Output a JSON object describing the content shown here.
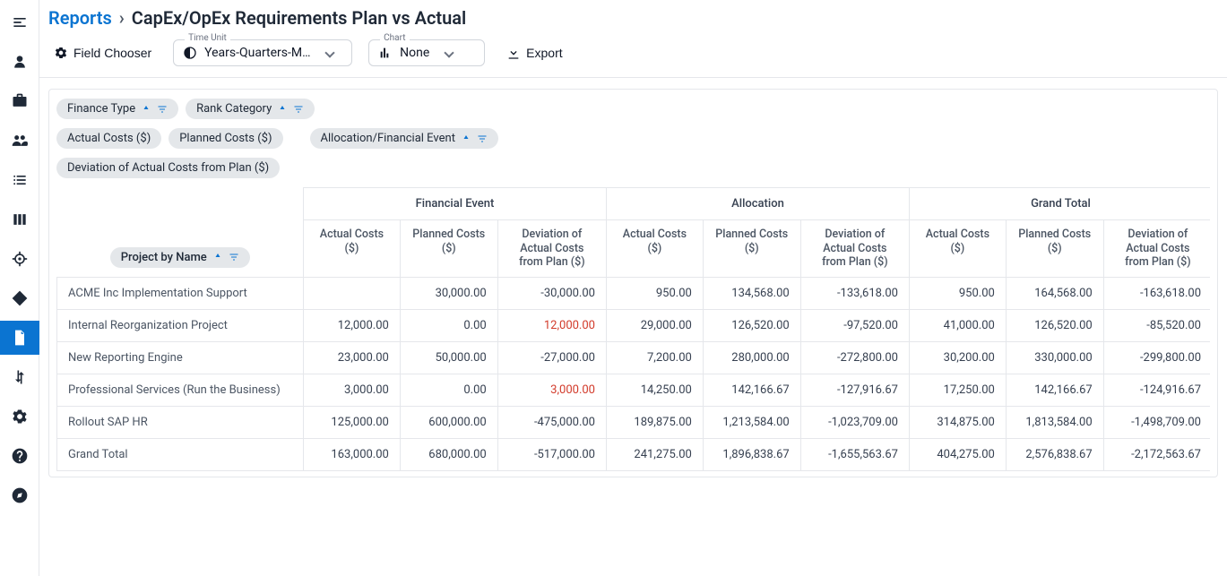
{
  "breadcrumb": {
    "root": "Reports",
    "title": "CapEx/OpEx Requirements Plan vs Actual"
  },
  "toolbar": {
    "fieldChooser": "Field Chooser",
    "timeUnitLabel": "Time Unit",
    "timeUnitValue": "Years-Quarters-M…",
    "chartLabel": "Chart",
    "chartValue": "None",
    "export": "Export"
  },
  "chips": {
    "financeType": "Finance Type",
    "rankCategory": "Rank Category",
    "actualCosts": "Actual Costs ($)",
    "plannedCosts": "Planned Costs ($)",
    "allocFinEvent": "Allocation/Financial Event",
    "deviation": "Deviation of Actual Costs from Plan ($)",
    "projectByName": "Project by Name"
  },
  "headers": {
    "group1": "Financial Event",
    "group2": "Allocation",
    "group3": "Grand Total",
    "actual": "Actual Costs ($)",
    "planned": "Planned Costs ($)",
    "dev": "Deviation of Actual Costs from Plan ($)"
  },
  "rows": [
    {
      "name": "ACME Inc Implementation Support",
      "fe_actual": "",
      "fe_planned": "30,000.00",
      "fe_dev": "-30,000.00",
      "al_actual": "950.00",
      "al_planned": "134,568.00",
      "al_dev": "-133,618.00",
      "gt_actual": "950.00",
      "gt_planned": "164,568.00",
      "gt_dev": "-163,618.00"
    },
    {
      "name": "Internal Reorganization Project",
      "fe_actual": "12,000.00",
      "fe_planned": "0.00",
      "fe_dev": "12,000.00",
      "fe_dev_pos": true,
      "al_actual": "29,000.00",
      "al_planned": "126,520.00",
      "al_dev": "-97,520.00",
      "gt_actual": "41,000.00",
      "gt_planned": "126,520.00",
      "gt_dev": "-85,520.00"
    },
    {
      "name": "New Reporting Engine",
      "fe_actual": "23,000.00",
      "fe_planned": "50,000.00",
      "fe_dev": "-27,000.00",
      "al_actual": "7,200.00",
      "al_planned": "280,000.00",
      "al_dev": "-272,800.00",
      "gt_actual": "30,200.00",
      "gt_planned": "330,000.00",
      "gt_dev": "-299,800.00"
    },
    {
      "name": "Professional Services (Run the Business)",
      "fe_actual": "3,000.00",
      "fe_planned": "0.00",
      "fe_dev": "3,000.00",
      "fe_dev_pos": true,
      "al_actual": "14,250.00",
      "al_planned": "142,166.67",
      "al_dev": "-127,916.67",
      "gt_actual": "17,250.00",
      "gt_planned": "142,166.67",
      "gt_dev": "-124,916.67"
    },
    {
      "name": "Rollout SAP HR",
      "fe_actual": "125,000.00",
      "fe_planned": "600,000.00",
      "fe_dev": "-475,000.00",
      "al_actual": "189,875.00",
      "al_planned": "1,213,584.00",
      "al_dev": "-1,023,709.00",
      "gt_actual": "314,875.00",
      "gt_planned": "1,813,584.00",
      "gt_dev": "-1,498,709.00"
    }
  ],
  "grandTotal": {
    "name": "Grand Total",
    "fe_actual": "163,000.00",
    "fe_planned": "680,000.00",
    "fe_dev": "-517,000.00",
    "al_actual": "241,275.00",
    "al_planned": "1,896,838.67",
    "al_dev": "-1,655,563.67",
    "gt_actual": "404,275.00",
    "gt_planned": "2,576,838.67",
    "gt_dev": "-2,172,563.67"
  }
}
